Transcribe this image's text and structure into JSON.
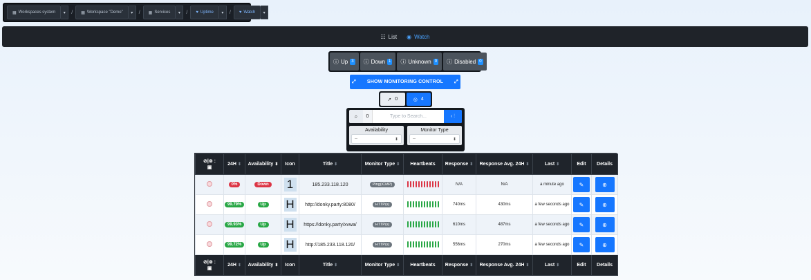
{
  "breadcrumb": {
    "items": [
      {
        "label": "Workspaces system",
        "accent": false
      },
      {
        "label": "Workspace \"Demo\"",
        "accent": false
      },
      {
        "label": "Services",
        "accent": false
      },
      {
        "label": "Uptime",
        "accent": true
      },
      {
        "label": "Watch",
        "accent": true
      }
    ],
    "separator": "/"
  },
  "view_bar": {
    "list_label": "List",
    "watch_label": "Watch",
    "active": "watch"
  },
  "status_filters": [
    {
      "label": "Up",
      "count": "3"
    },
    {
      "label": "Down",
      "count": "1"
    },
    {
      "label": "Unknown",
      "count": "0"
    },
    {
      "label": "Disabled",
      "count": "0"
    }
  ],
  "monitoring_control": {
    "label": "SHOW MONITORING CONTROL"
  },
  "selection": {
    "selected_count": "0",
    "total_count": "4"
  },
  "search": {
    "count": "0",
    "placeholder": "Type to Search..."
  },
  "filters": [
    {
      "label": "Availability",
      "value": "--"
    },
    {
      "label": "Monitor Type",
      "value": "--"
    }
  ],
  "table": {
    "columns": [
      "24H",
      "Availability",
      "Icon",
      "Title",
      "Monitor Type",
      "Heartbeats",
      "Response",
      "Response Avg. 24H",
      "Last",
      "Edit",
      "Details"
    ],
    "rows": [
      {
        "uptime": "0%",
        "uptime_color": "red",
        "availability": "Down",
        "availability_color": "red",
        "icon": "1",
        "title": "185.233.118.120",
        "type": "Ping(ICMP)",
        "beat_status": "down",
        "response": "N/A",
        "response_avg": "N/A",
        "last": "a minute ago"
      },
      {
        "uptime": "99.79%",
        "uptime_color": "green",
        "availability": "Up",
        "availability_color": "green",
        "icon": "H",
        "title": "http://donky.party:8080/",
        "type": "HTTP(s)",
        "beat_status": "up",
        "response": "740ms",
        "response_avg": "430ms",
        "last": "a few seconds ago"
      },
      {
        "uptime": "99.93%",
        "uptime_color": "green",
        "availability": "Up",
        "availability_color": "green",
        "icon": "H",
        "title": "https://donky.party/xvwa/",
        "type": "HTTP(s)",
        "beat_status": "up",
        "response": "610ms",
        "response_avg": "487ms",
        "last": "a few seconds ago"
      },
      {
        "uptime": "99.72%",
        "uptime_color": "green",
        "availability": "Up",
        "availability_color": "green",
        "icon": "H",
        "title": "http://185.233.118.120/",
        "type": "HTTP(s)",
        "beat_status": "up",
        "response": "556ms",
        "response_avg": "270ms",
        "last": "a few seconds ago"
      }
    ]
  },
  "colors": {
    "primary": "#1677ff",
    "header_dark": "#1f242b",
    "down_red": "#dc3545",
    "up_green": "#28a745"
  }
}
